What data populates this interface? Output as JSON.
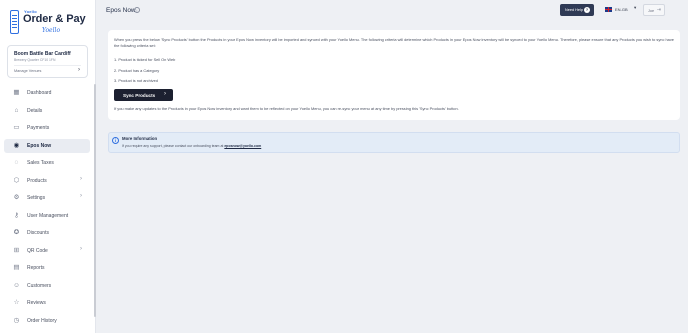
{
  "brand": {
    "small": "Yoello",
    "main": "Order & Pay",
    "script": "Yoello"
  },
  "venue": {
    "name": "Boom Battle Bar Cardiff",
    "sub": "Brewery Quarter CF10 1FN",
    "manage": "Manage Venues"
  },
  "nav": {
    "items": [
      {
        "label": "Dashboard",
        "icon": "dashboard-icon"
      },
      {
        "label": "Details",
        "icon": "home-icon"
      },
      {
        "label": "Payments",
        "icon": "card-icon"
      },
      {
        "label": "Epos Now",
        "icon": "epos-icon"
      },
      {
        "label": "Sales Taxes",
        "icon": "tax-icon"
      },
      {
        "label": "Products",
        "icon": "products-icon"
      },
      {
        "label": "Settings",
        "icon": "gear-icon"
      },
      {
        "label": "User Management",
        "icon": "key-icon"
      },
      {
        "label": "Discounts",
        "icon": "discount-icon"
      },
      {
        "label": "QR Code",
        "icon": "qr-icon"
      },
      {
        "label": "Reports",
        "icon": "reports-icon"
      },
      {
        "label": "Customers",
        "icon": "customers-icon"
      },
      {
        "label": "Reviews",
        "icon": "star-icon"
      },
      {
        "label": "Order History",
        "icon": "history-icon"
      }
    ],
    "active": "Epos Now"
  },
  "topbar": {
    "title": "Epos Now",
    "help_label": "Need Help",
    "language": "EN-GB",
    "user": "Joe"
  },
  "content": {
    "intro": "When you press the below 'Sync Products' button the Products in your Epos Now inventory will be imported and synced with your Yoello Menu. The following criteria will determine which Products in your Epos Now inventory will be synced to your Yoello Menu. Therefore, please ensure that any Products you wish to sync have the following criteria set:",
    "criteria": [
      "1. Product is ticked for Sell On Web",
      "2. Product has a Category",
      "3. Product is not archived"
    ],
    "sync_button": "Sync Products",
    "outro": "If you make any updates to the Products in your Epos Now inventory and want them to be reflected on your Yoello Menu, you can re-sync your menu at any time by pressing this 'Sync Products' button."
  },
  "info": {
    "title": "More Information",
    "text": "If you require any support, please contact our onboarding team at",
    "link": "eposnow@yoello.com"
  }
}
